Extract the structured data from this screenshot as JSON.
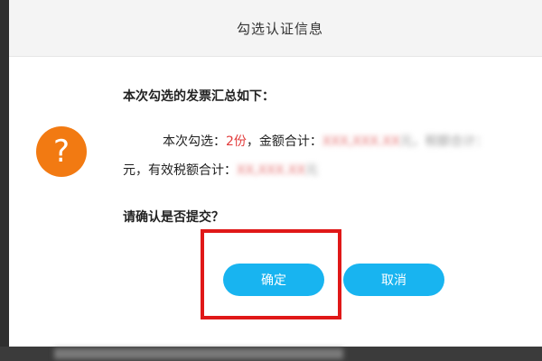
{
  "dialog": {
    "title": "勾选认证信息",
    "heading": "本次勾选的发票汇总如下：",
    "summary": {
      "prefix": "本次勾选：",
      "count": "2份",
      "amount_label": "，金额合计：",
      "amount_value": "XXX,XXX.XX",
      "after_amount": "元，税额合计：",
      "line2_prefix": "元，有效税额合计：",
      "tax_value": "XX,XXX.XX",
      "line2_suffix": "元"
    },
    "confirm_question": "请确认是否提交？",
    "buttons": {
      "ok": "确定",
      "cancel": "取消"
    },
    "icon": "question-icon"
  },
  "colors": {
    "accent": "#18b4f0",
    "icon": "#f27a12",
    "highlight": "#e01818",
    "count": "#e23b3b"
  }
}
